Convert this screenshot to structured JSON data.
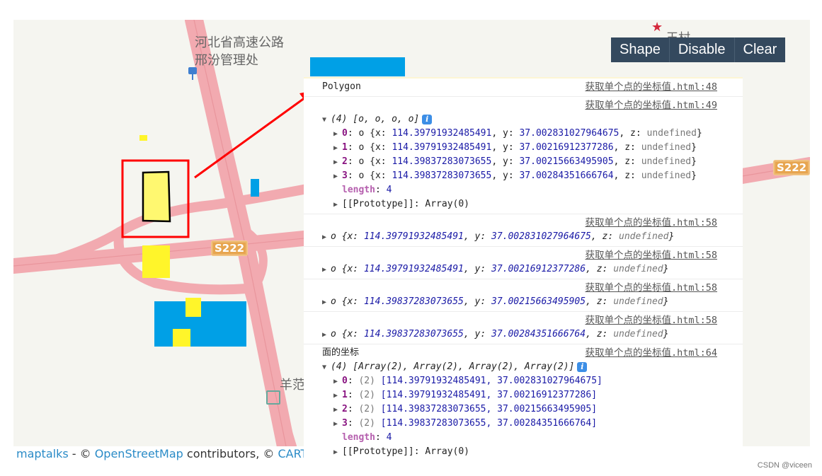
{
  "toolbar": {
    "buttons": [
      "Shape",
      "Disable",
      "Clear"
    ]
  },
  "map": {
    "labels": {
      "poi_line1": "河北省高速公路",
      "poi_line2": "邢汾管理处",
      "village_right": "王村",
      "village_bottom": "羊范"
    },
    "road_shields": [
      "S222",
      "S222"
    ],
    "colors": {
      "road": "#f2aab0",
      "background": "#f5f5f0",
      "yellow": "#fff52a",
      "blue": "#00a0e6",
      "highlight": "#ff0000"
    }
  },
  "attribution": {
    "brand": "maptalks",
    "sep": " - © ",
    "osm": "OpenStreetMap",
    "mid": " contributors, © ",
    "carto": "CARTO"
  },
  "watermark": "CSDN @viceen",
  "console": {
    "polygon_msg": {
      "text": "Polygon",
      "source": "获取单个点的坐标值.html:48"
    },
    "array_msg": {
      "source": "获取单个点的坐标值.html:49",
      "summary": "(4) [o, o, o, o]",
      "items": [
        {
          "idx": "0",
          "x": "114.39791932485491",
          "y": "37.002831027964675",
          "z": "undefined"
        },
        {
          "idx": "1",
          "x": "114.39791932485491",
          "y": "37.00216912377286",
          "z": "undefined"
        },
        {
          "idx": "2",
          "x": "114.39837283073655",
          "y": "37.00215663495905",
          "z": "undefined"
        },
        {
          "idx": "3",
          "x": "114.39837283073655",
          "y": "37.00284351666764",
          "z": "undefined"
        }
      ],
      "length_label": "length",
      "length": "4",
      "prototype": "[[Prototype]]: Array(0)"
    },
    "point_msgs": [
      {
        "source": "获取单个点的坐标值.html:58",
        "x": "114.39791932485491",
        "y": "37.002831027964675",
        "z": "undefined"
      },
      {
        "source": "获取单个点的坐标值.html:58",
        "x": "114.39791932485491",
        "y": "37.00216912377286",
        "z": "undefined"
      },
      {
        "source": "获取单个点的坐标值.html:58",
        "x": "114.39837283073655",
        "y": "37.00215663495905",
        "z": "undefined"
      },
      {
        "source": "获取单个点的坐标值.html:58",
        "x": "114.39837283073655",
        "y": "37.00284351666764",
        "z": "undefined"
      }
    ],
    "coords_msg": {
      "label": "面的坐标",
      "source": "获取单个点的坐标值.html:64",
      "summary": "(4) [Array(2), Array(2), Array(2), Array(2)]",
      "items": [
        {
          "idx": "0",
          "pair": "[114.39791932485491, 37.002831027964675]"
        },
        {
          "idx": "1",
          "pair": "[114.39791932485491, 37.00216912377286]"
        },
        {
          "idx": "2",
          "pair": "[114.39837283073655, 37.00215663495905]"
        },
        {
          "idx": "3",
          "pair": "[114.39837283073655, 37.00284351666764]"
        }
      ],
      "length_label": "length",
      "length": "4",
      "prototype": "[[Prototype]]: Array(0)"
    }
  }
}
